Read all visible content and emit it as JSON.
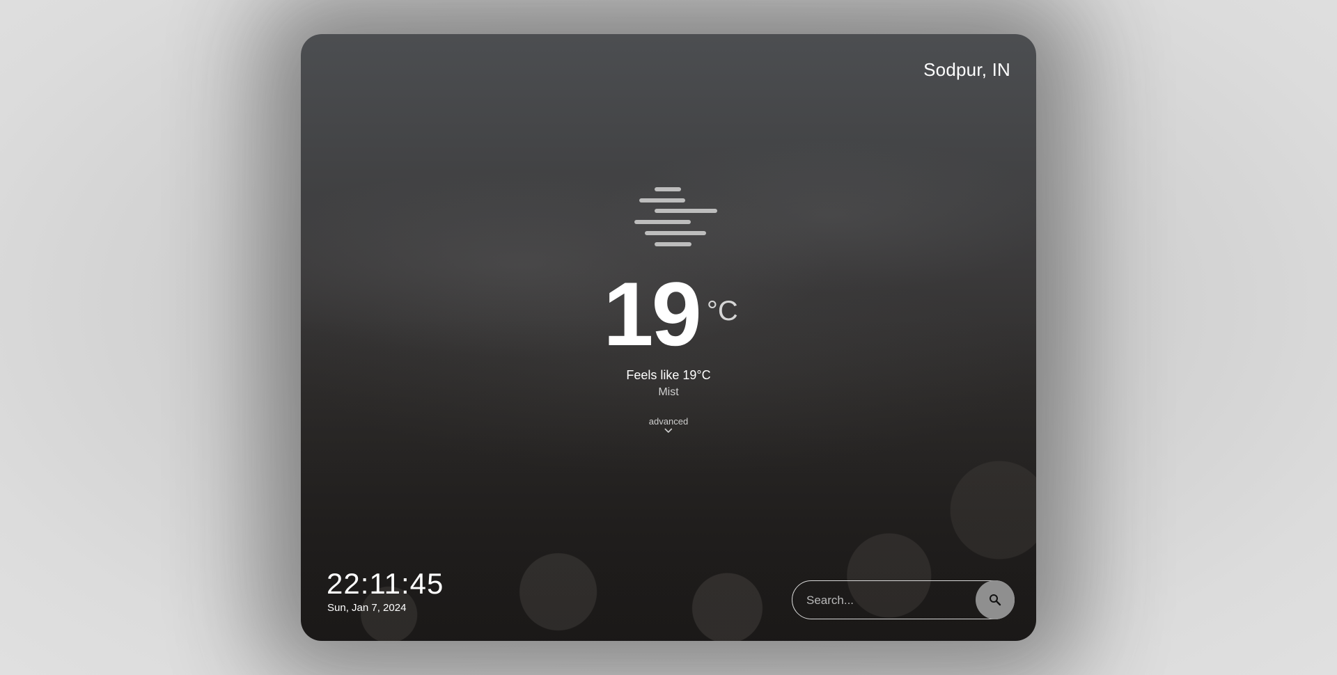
{
  "location": "Sodpur, IN",
  "weather": {
    "icon": "mist-icon",
    "temperature": "19",
    "unit": "°C",
    "feels_like": "Feels like 19°C",
    "condition": "Mist"
  },
  "advanced": {
    "label": "advanced",
    "icon": "chevron-down-icon"
  },
  "clock": {
    "time": "22:11:45",
    "date": "Sun, Jan 7, 2024"
  },
  "search": {
    "placeholder": "Search...",
    "value": "",
    "button_icon": "search-icon"
  },
  "colors": {
    "text_primary": "#ffffff",
    "text_secondary": "#d0d0d0",
    "search_button": "#8f8f8f",
    "icon_bars": "#bdbdbd"
  }
}
